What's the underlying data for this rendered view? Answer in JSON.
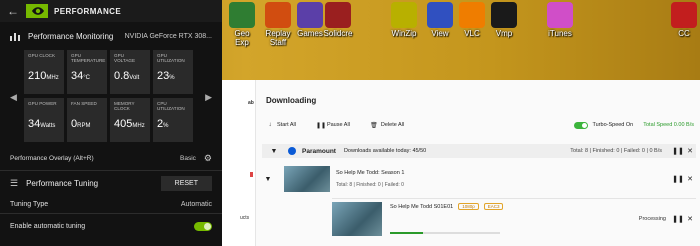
{
  "desktop": {
    "icons": [
      {
        "label": "Geo\nExp",
        "color": "#2f7d32"
      },
      {
        "label": "Replay\nStaff",
        "color": "#d14d10"
      },
      {
        "label": "Games",
        "color": "#5b3fa8"
      },
      {
        "label": "Solidcre",
        "color": "#9a1f1f"
      },
      {
        "label": "WinZip",
        "color": "#b8b000"
      },
      {
        "label": "View",
        "color": "#3050c0"
      },
      {
        "label": "VLC",
        "color": "#ef7d00"
      },
      {
        "label": "Vmp",
        "color": "#1a1a1a"
      },
      {
        "label": "iTunes",
        "color": "#d04ec8"
      },
      {
        "label": "CC",
        "color": "#c21e1e"
      }
    ]
  },
  "overlay": {
    "title": "PERFORMANCE",
    "section_title": "Performance Monitoring",
    "gpu_name": "NVIDIA GeForce RTX 308...",
    "tiles": [
      {
        "label": "GPU CLOCK",
        "value": "210",
        "unit": "MHz"
      },
      {
        "label": "GPU TEMPERATURE",
        "value": "34",
        "unit": "°C"
      },
      {
        "label": "GPU VOLTAGE",
        "value": "0.8",
        "unit": "Volt"
      },
      {
        "label": "GPU UTILIZATION",
        "value": "23",
        "unit": "%"
      },
      {
        "label": "GPU POWER",
        "value": "34",
        "unit": "Watts"
      },
      {
        "label": "FAN SPEED",
        "value": "0",
        "unit": "RPM"
      },
      {
        "label": "MEMORY CLOCK",
        "value": "405",
        "unit": "MHz"
      },
      {
        "label": "CPU UTILIZATION",
        "value": "2",
        "unit": "%"
      }
    ],
    "overlay_label": "Performance Overlay (Alt+R)",
    "overlay_mode": "Basic",
    "tuning_label": "Performance Tuning",
    "reset_label": "RESET",
    "tuning_type_label": "Tuning Type",
    "tuning_type_value": "Automatic",
    "auto_tuning_label": "Enable automatic tuning",
    "auto_tuning_on": true
  },
  "app": {
    "sidebar_labels": [
      "ab",
      "ucts"
    ],
    "title": "Downloading",
    "toolbar": {
      "start_all": "Start All",
      "pause_all": "Pause All",
      "delete_all": "Delete All",
      "turbo_label": "Turbo-Speed On",
      "total_speed": "Total Speed 0.00 B/s"
    },
    "group": {
      "service": "Paramount",
      "available": "Downloads available today: 45/50",
      "stats": "Total: 8  |  Finished: 0  |  Failed: 0  |  0 B/s"
    },
    "season": {
      "title": "So Help Me Todd: Season 1",
      "stats": "Total: 8  |  Finished: 0  |  Failed: 0"
    },
    "episode": {
      "title": "So Help Me Todd S01E01",
      "quality": "1080p",
      "audio": "EAC3",
      "status": "Processing",
      "progress": 0.3
    }
  }
}
